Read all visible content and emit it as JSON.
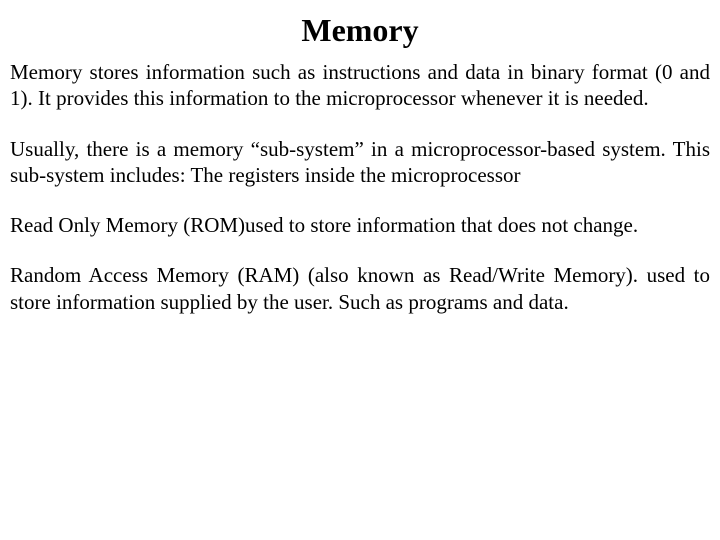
{
  "title": "Memory",
  "paragraphs": [
    "Memory stores information such as instructions and data in binary format (0 and 1). It provides this information to the microprocessor whenever it is needed.",
    "Usually, there is a memory “sub-system” in a microprocessor-based system. This sub-system includes: The registers inside the microprocessor",
    "Read Only Memory (ROM)used to store information that does not change.",
    "Random Access Memory (RAM) (also known as Read/Write Memory). used to store information supplied by the user. Such as programs and data."
  ]
}
